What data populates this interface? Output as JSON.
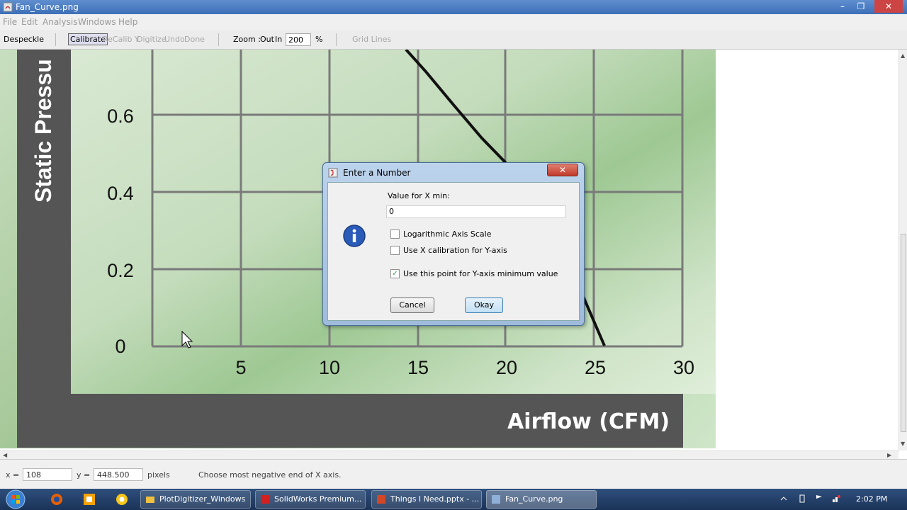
{
  "window": {
    "title": "Fan_Curve.png",
    "minimize": "–",
    "maximize": "❐",
    "close": "✕"
  },
  "menu": [
    "File",
    "Edit",
    "Analysis",
    "Windows",
    "Help"
  ],
  "toolbar": {
    "despeckle": "Despeckle",
    "calibrate": "Calibrate",
    "recalib_y": "ReCalib Y",
    "digitize": "Digitize",
    "undo": "Undo",
    "done": "Done",
    "zoom_label": "Zoom :",
    "zoom_out": "Out",
    "zoom_in": "In",
    "zoom_value": "200",
    "zoom_unit": "%",
    "grid_lines": "Grid Lines"
  },
  "image": {
    "y_axis_title": "Static Pressu",
    "x_axis_title": "Airflow (CFM)",
    "y_ticks": [
      "0.6",
      "0.4",
      "0.2",
      "0"
    ],
    "x_ticks": [
      "5",
      "10",
      "15",
      "20",
      "25",
      "30"
    ]
  },
  "dialog": {
    "title": "Enter a Number",
    "close": "✕",
    "prompt": "Value for X min:",
    "input_value": "0",
    "options": [
      {
        "label": "Logarithmic Axis Scale",
        "checked": false
      },
      {
        "label": "Use X calibration for Y-axis",
        "checked": false
      },
      {
        "label": "Use this point for Y-axis minimum value",
        "checked": true
      }
    ],
    "cancel": "Cancel",
    "okay": "Okay",
    "check_mark": "✓"
  },
  "status": {
    "x_label": "x =",
    "x_value": "108",
    "y_label": "y =",
    "y_value": "448.500",
    "units": "pixels",
    "message": "Choose most negative end of X axis."
  },
  "taskbar": {
    "tasks": [
      {
        "label": "PlotDigitizer_Windows",
        "color": "#f0c040"
      },
      {
        "label": "SolidWorks Premium...",
        "color": "#d02020"
      },
      {
        "label": "Things I Need.pptx - ...",
        "color": "#d24726"
      },
      {
        "label": "Fan_Curve.png",
        "color": "#8fb0d8"
      }
    ],
    "time": "2:02 PM"
  }
}
